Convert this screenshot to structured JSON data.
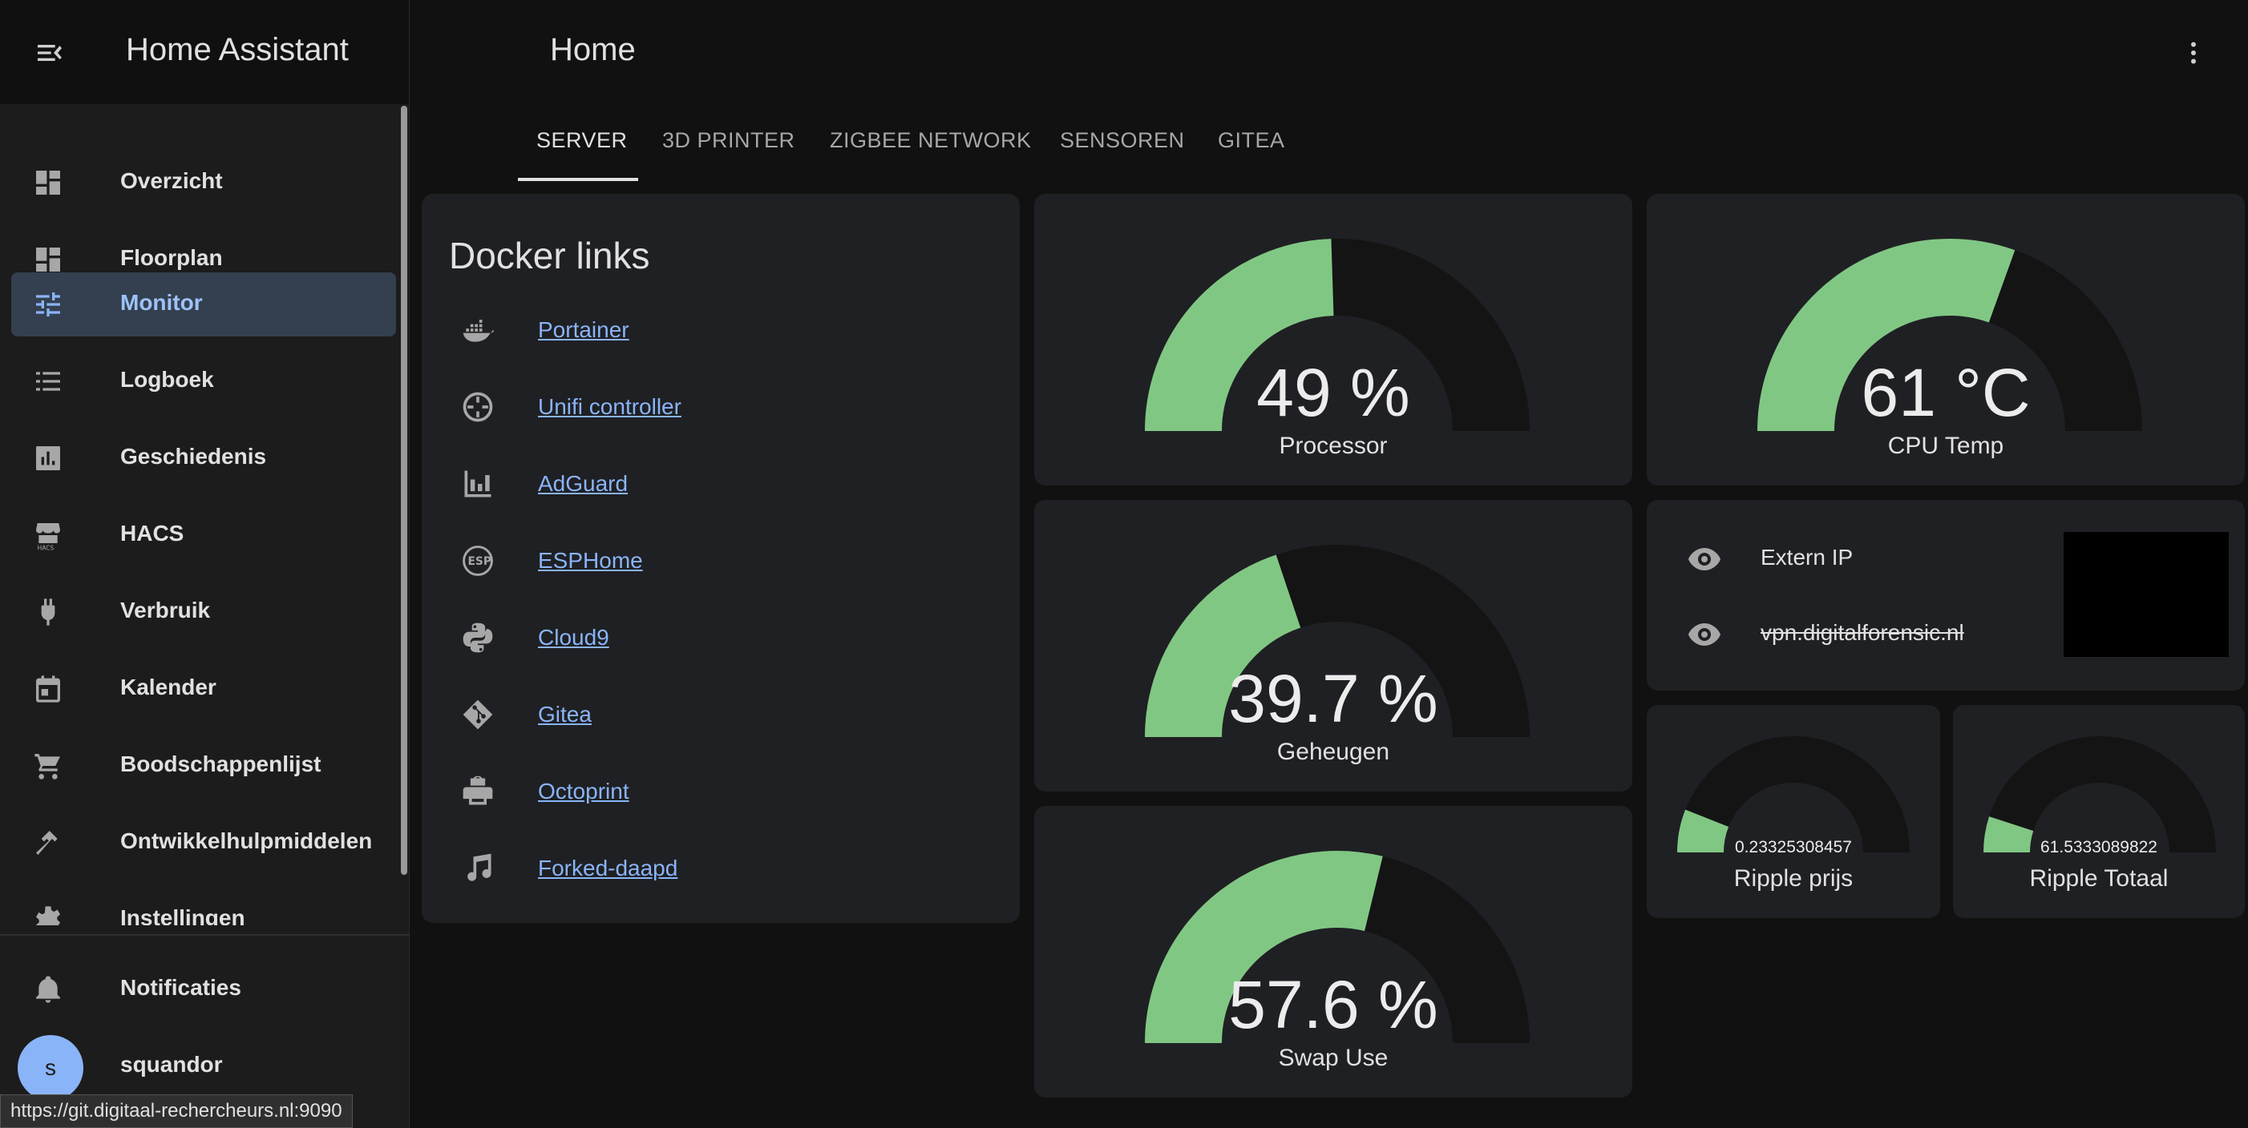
{
  "app": {
    "title": "Home Assistant"
  },
  "page": {
    "title": "Home"
  },
  "sidebar": {
    "items": [
      {
        "label": "Overzicht",
        "icon": "dashboard-icon",
        "active": false
      },
      {
        "label": "Floorplan",
        "icon": "dashboard-icon",
        "active": false
      },
      {
        "label": "Monitor",
        "icon": "tune-icon",
        "active": true
      },
      {
        "label": "Logboek",
        "icon": "list-icon",
        "active": false
      },
      {
        "label": "Geschiedenis",
        "icon": "chart-box-icon",
        "active": false
      },
      {
        "label": "HACS",
        "icon": "hacs-store-icon",
        "active": false
      },
      {
        "label": "Verbruik",
        "icon": "plug-icon",
        "active": false
      },
      {
        "label": "Kalender",
        "icon": "calendar-icon",
        "active": false
      },
      {
        "label": "Boodschappenlijst",
        "icon": "cart-icon",
        "active": false
      },
      {
        "label": "Ontwikkelhulpmiddelen",
        "icon": "hammer-icon",
        "active": false
      },
      {
        "label": "Instellingen",
        "icon": "cog-icon",
        "active": false
      }
    ],
    "notifications_label": "Notificaties",
    "user": {
      "name": "squandor",
      "initial": "s"
    }
  },
  "tabs": [
    {
      "label": "SERVER",
      "active": true
    },
    {
      "label": "3D PRINTER",
      "active": false
    },
    {
      "label": "ZIGBEE NETWORK",
      "active": false
    },
    {
      "label": "SENSOREN",
      "active": false
    },
    {
      "label": "GITEA",
      "active": false
    }
  ],
  "docker_card": {
    "title": "Docker links",
    "links": [
      {
        "label": "Portainer",
        "icon": "docker-icon"
      },
      {
        "label": "Unifi controller",
        "icon": "unifi-icon"
      },
      {
        "label": "AdGuard",
        "icon": "bar-chart-icon"
      },
      {
        "label": "ESPHome",
        "icon": "esphome-icon"
      },
      {
        "label": "Cloud9",
        "icon": "python-icon"
      },
      {
        "label": "Gitea",
        "icon": "git-icon"
      },
      {
        "label": "Octoprint",
        "icon": "printer-icon"
      },
      {
        "label": "Forked-daapd",
        "icon": "music-note-icon"
      }
    ]
  },
  "gauges": {
    "processor": {
      "value": "49 %",
      "name": "Processor",
      "fraction": 0.49
    },
    "cpu_temp": {
      "value": "61 °C",
      "name": "CPU Temp",
      "fraction": 0.61
    },
    "memory": {
      "value": "39.7 %",
      "name": "Geheugen",
      "fraction": 0.397
    },
    "swap": {
      "value": "57.6 %",
      "name": "Swap Use",
      "fraction": 0.576
    },
    "ripple_price": {
      "value": "0.23325308457",
      "name": "Ripple prijs",
      "fraction": 0.12
    },
    "ripple_total": {
      "value": "61.5333089822",
      "name": "Ripple Totaal",
      "fraction": 0.1
    }
  },
  "extern_ip": {
    "label": "Extern IP",
    "value": "vpn.digitalforensic.nl"
  },
  "status_url": "https://git.digitaal-rechercheurs.nl:9090",
  "colors": {
    "gauge_fill": "#81c784",
    "gauge_track": "#141414",
    "link": "#8ab4f8",
    "active_nav_bg": "#34404f"
  }
}
